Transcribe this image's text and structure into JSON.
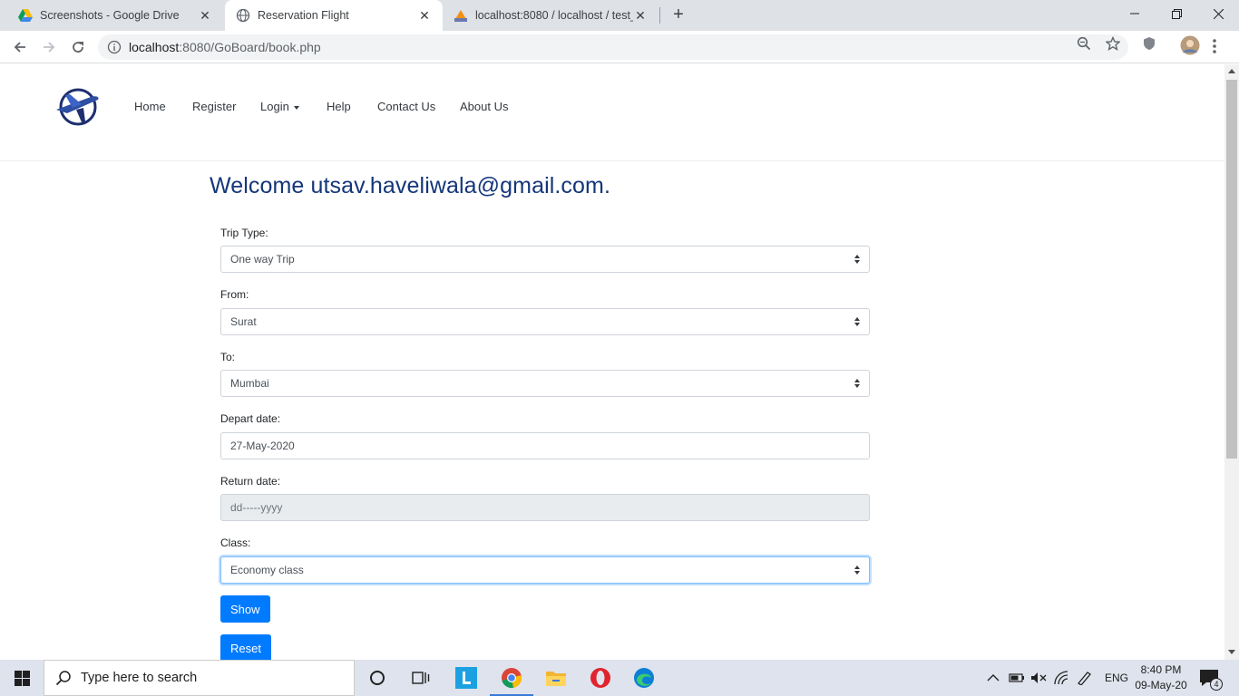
{
  "browser": {
    "tabs": [
      {
        "title": "Screenshots - Google Drive",
        "icon": "google-drive-icon"
      },
      {
        "title": "Reservation Flight",
        "icon": "globe-icon"
      },
      {
        "title": "localhost:8080 / localhost / test_c",
        "icon": "phpmyadmin-icon"
      }
    ],
    "new_tab_label": "+",
    "url_host": "localhost",
    "url_rest": ":8080/GoBoard/book.php"
  },
  "site": {
    "nav": [
      {
        "label": "Home"
      },
      {
        "label": "Register"
      },
      {
        "label": "Login"
      },
      {
        "label": "Help"
      },
      {
        "label": "Contact Us"
      },
      {
        "label": "About Us"
      }
    ],
    "welcome": "Welcome utsav.haveliwala@gmail.com."
  },
  "form": {
    "trip_type": {
      "label": "Trip Type:",
      "value": "One way Trip"
    },
    "from": {
      "label": "From:",
      "value": "Surat"
    },
    "to": {
      "label": "To:",
      "value": "Mumbai"
    },
    "depart": {
      "label": "Depart date:",
      "value": "27-May-2020"
    },
    "return": {
      "label": "Return date:",
      "placeholder": "dd-----yyyy"
    },
    "class": {
      "label": "Class:",
      "value": "Economy class"
    },
    "show_button": "Show",
    "reset_button": "Reset"
  },
  "taskbar": {
    "search_placeholder": "Type here to search",
    "language": "ENG",
    "time": "8:40 PM",
    "date": "09-May-20",
    "notification_count": "4"
  },
  "colors": {
    "primary": "#007bff",
    "welcome": "#14367a",
    "tabstrip": "#dee1e6"
  }
}
